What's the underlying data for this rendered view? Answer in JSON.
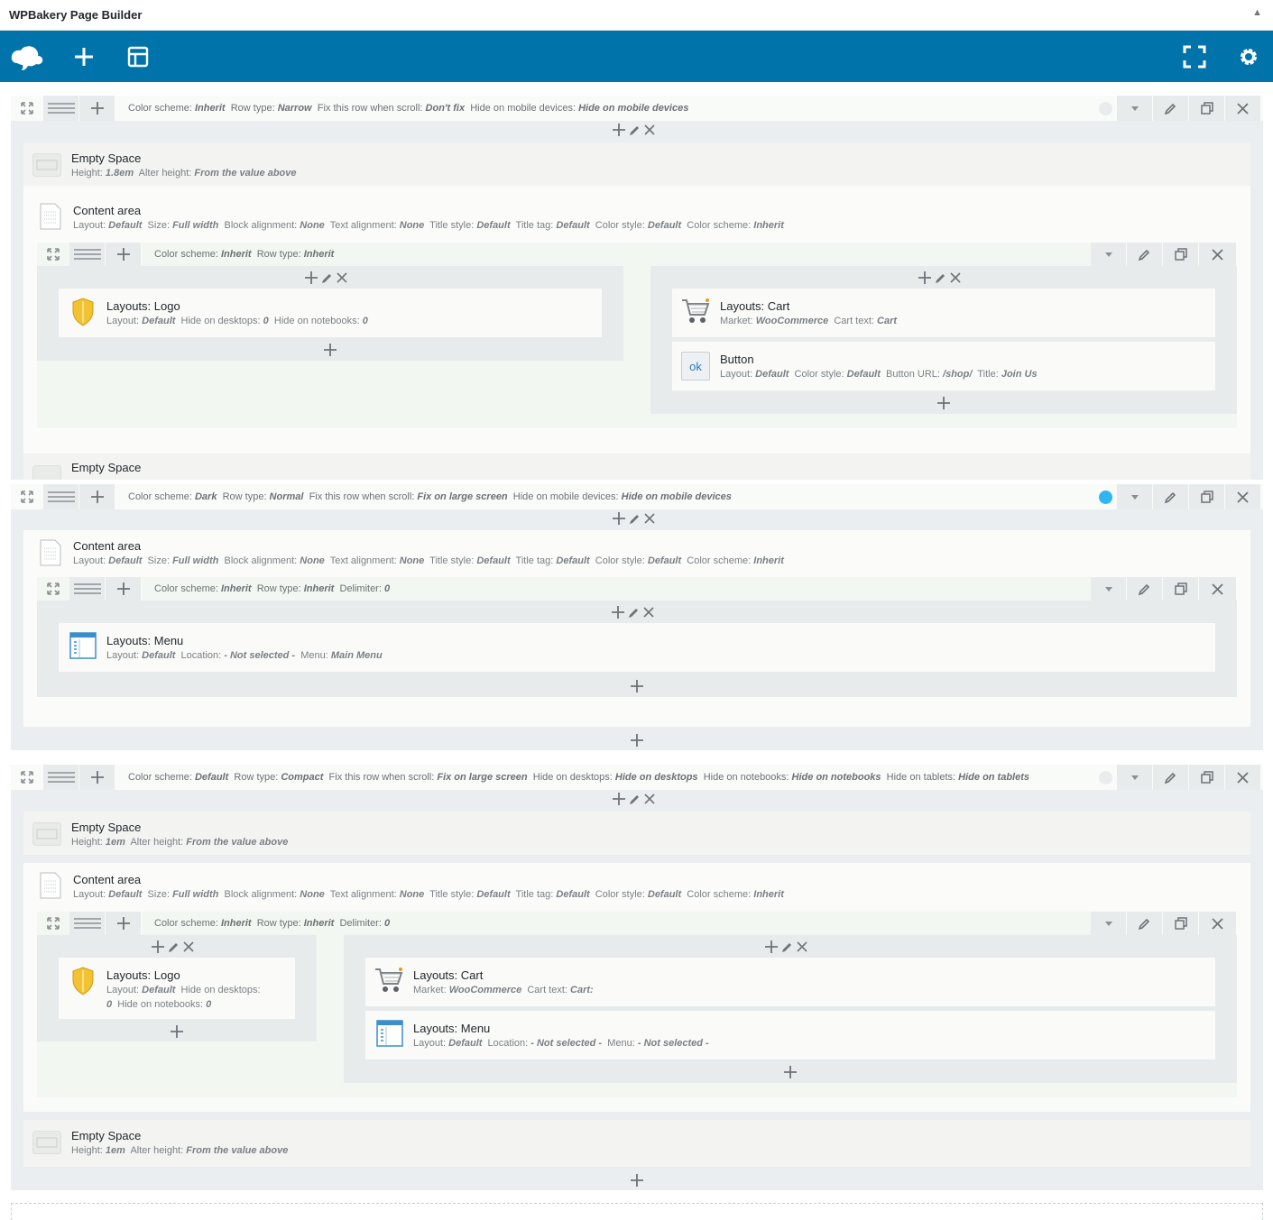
{
  "panel": {
    "title": "WPBakery Page Builder",
    "toggle": "▲"
  },
  "toolbar": {
    "logo_icon": "cloud-logo-icon",
    "add_icon": "plus-icon",
    "templates_icon": "layout-template-icon",
    "fullscreen_icon": "fullscreen-icon",
    "settings_icon": "gear-icon"
  },
  "rows": [
    {
      "desc": [
        [
          "Color scheme: ",
          "Inherit"
        ],
        [
          "Row type: ",
          "Narrow"
        ],
        [
          "Fix this row when scroll: ",
          "Don't fix"
        ],
        [
          "Hide on mobile devices: ",
          "Hide on mobile devices"
        ]
      ]
    },
    {
      "desc": [
        [
          "Color scheme: ",
          "Dark"
        ],
        [
          "Row type: ",
          "Normal"
        ],
        [
          "Fix this row when scroll: ",
          "Fix on large screen"
        ],
        [
          " Hide on mobile devices: ",
          "Hide on mobile devices"
        ]
      ]
    },
    {
      "desc": [
        [
          "Color scheme: ",
          "Default"
        ],
        [
          "Row type: ",
          "Compact"
        ],
        [
          "Fix this row when scroll: ",
          "Fix on large screen"
        ],
        [
          " Hide on desktops: ",
          "Hide on desktops"
        ],
        [
          "Hide on notebooks: ",
          "Hide on notebooks"
        ],
        [
          "Hide on tablets: ",
          "Hide on tablets"
        ]
      ]
    }
  ],
  "elements": {
    "empty_space_1": {
      "name": "Empty Space",
      "desc": [
        [
          "Height: ",
          "1.8em"
        ],
        [
          "Alter height: ",
          "From the value above"
        ]
      ]
    },
    "content_area_1": {
      "name": "Content area",
      "desc": [
        [
          "Layout: ",
          "Default"
        ],
        [
          "Size: ",
          "Full width"
        ],
        [
          "Block alignment: ",
          "None"
        ],
        [
          "Text alignment: ",
          "None"
        ],
        [
          "Title style: ",
          "Default"
        ],
        [
          "Title tag: ",
          "Default"
        ],
        [
          "Color style: ",
          "Default"
        ],
        [
          "Color scheme: ",
          "Inherit"
        ]
      ]
    },
    "inner_row_1": {
      "desc": [
        [
          "Color scheme: ",
          "Inherit"
        ],
        [
          "Row type: ",
          "Inherit"
        ]
      ]
    },
    "logo_1": {
      "name": "Layouts: Logo",
      "desc": [
        [
          "Layout: ",
          "Default"
        ],
        [
          "Hide on desktops: ",
          "0"
        ],
        [
          "Hide on notebooks: ",
          "0"
        ]
      ]
    },
    "cart_1": {
      "name": "Layouts: Cart",
      "desc": [
        [
          "Market: ",
          "WooCommerce"
        ],
        [
          "Cart text: ",
          "Cart"
        ]
      ]
    },
    "button_1": {
      "name": "Button",
      "icon_text": "ok",
      "desc": [
        [
          "Layout: ",
          "Default"
        ],
        [
          "Color style: ",
          "Default"
        ],
        [
          "Button URL: ",
          "/shop/"
        ],
        [
          "Title: ",
          "Join Us"
        ]
      ]
    },
    "empty_space_2": {
      "name": "Empty Space"
    },
    "content_area_2": {
      "name": "Content area",
      "desc": [
        [
          "Layout: ",
          "Default"
        ],
        [
          "Size: ",
          "Full width"
        ],
        [
          "Block alignment: ",
          "None"
        ],
        [
          "Text alignment: ",
          "None"
        ],
        [
          "Title style: ",
          "Default"
        ],
        [
          "Title tag: ",
          "Default"
        ],
        [
          "Color style: ",
          "Default"
        ],
        [
          "Color scheme: ",
          "Inherit"
        ]
      ]
    },
    "inner_row_2": {
      "desc": [
        [
          "Color scheme: ",
          "Inherit"
        ],
        [
          "Row type: ",
          "Inherit"
        ],
        [
          "Delimiter: ",
          "0"
        ]
      ]
    },
    "menu_1": {
      "name": "Layouts: Menu",
      "desc": [
        [
          "Layout: ",
          "Default"
        ],
        [
          "Location: ",
          "- Not selected -"
        ],
        [
          "Menu: ",
          "Main Menu"
        ]
      ]
    },
    "empty_space_3": {
      "name": "Empty Space",
      "desc": [
        [
          "Height: ",
          "1em"
        ],
        [
          "Alter height: ",
          "From the value above"
        ]
      ]
    },
    "content_area_3": {
      "name": "Content area",
      "desc": [
        [
          "Layout: ",
          "Default"
        ],
        [
          "Size: ",
          "Full width"
        ],
        [
          "Block alignment: ",
          "None"
        ],
        [
          "Text alignment: ",
          "None"
        ],
        [
          "Title style: ",
          "Default"
        ],
        [
          "Title tag: ",
          "Default"
        ],
        [
          "Color style: ",
          "Default"
        ],
        [
          "Color scheme: ",
          "Inherit"
        ]
      ]
    },
    "inner_row_3": {
      "desc": [
        [
          "Color scheme: ",
          "Inherit"
        ],
        [
          "Row type: ",
          "Inherit"
        ],
        [
          "Delimiter: ",
          "0"
        ]
      ]
    },
    "logo_2": {
      "name": "Layouts: Logo",
      "desc_line1": [
        [
          "Layout: ",
          "Default"
        ],
        [
          "Hide on desktops: ",
          ""
        ]
      ],
      "desc_line2": [
        [
          "",
          "0"
        ],
        [
          "Hide on notebooks: ",
          "0"
        ]
      ]
    },
    "cart_2": {
      "name": "Layouts: Cart",
      "desc": [
        [
          "Market: ",
          "WooCommerce"
        ],
        [
          "Cart text: ",
          "Cart:"
        ]
      ]
    },
    "menu_2": {
      "name": "Layouts: Menu",
      "desc": [
        [
          "Layout: ",
          "Default"
        ],
        [
          "Location: ",
          "- Not selected -"
        ],
        [
          "Menu: ",
          "- Not selected -"
        ]
      ]
    },
    "empty_space_4": {
      "name": "Empty Space",
      "desc": [
        [
          "Height: ",
          "1em"
        ],
        [
          "Alter height: ",
          "From the value above"
        ]
      ]
    }
  }
}
